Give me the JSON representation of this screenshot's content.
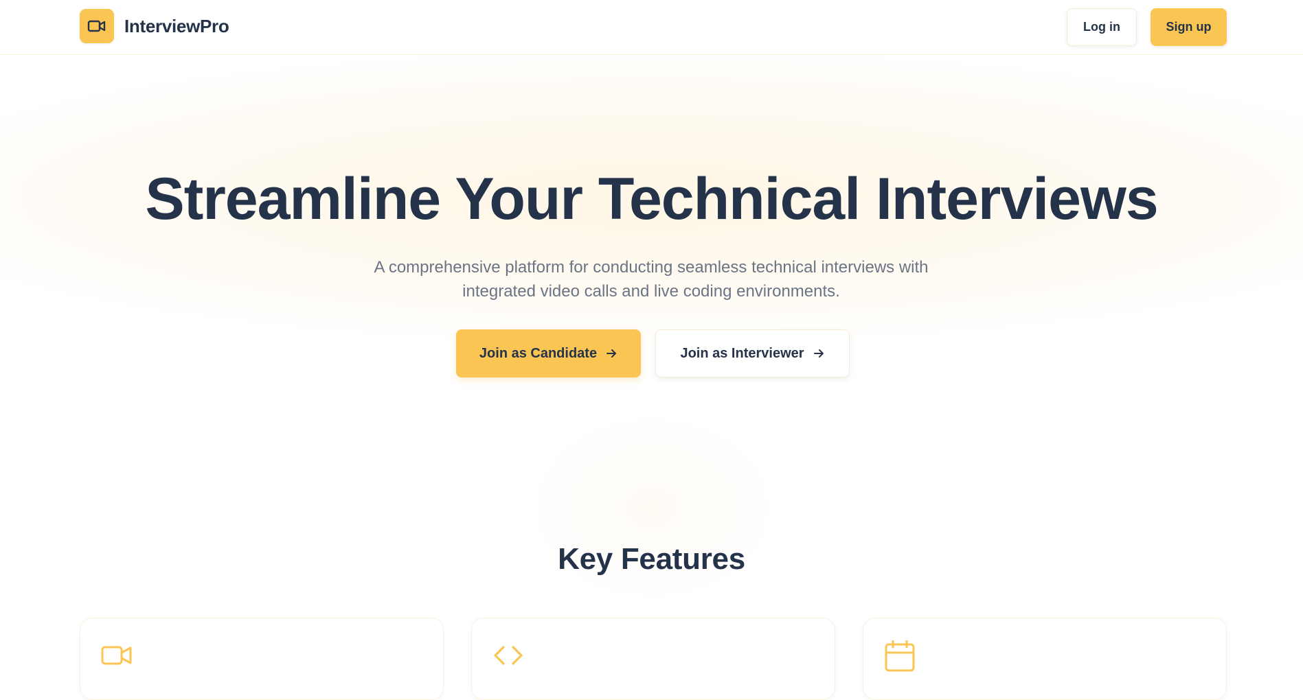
{
  "brand": {
    "name": "InterviewPro",
    "logo_icon": "video-camera-icon",
    "accent_color": "#fbc553"
  },
  "nav": {
    "login_label": "Log in",
    "signup_label": "Sign up"
  },
  "hero": {
    "title": "Streamline Your Technical Interviews",
    "subtitle": "A comprehensive platform for conducting seamless technical interviews with integrated video calls and live coding environments.",
    "cta_candidate": "Join as Candidate",
    "cta_interviewer": "Join as Interviewer",
    "cta_icon": "arrow-right-icon"
  },
  "features": {
    "title": "Key Features",
    "cards": [
      {
        "icon": "video-camera-icon"
      },
      {
        "icon": "code-icon"
      },
      {
        "icon": "calendar-icon"
      }
    ]
  },
  "colors": {
    "text": "#243349",
    "muted": "#6b7484",
    "accent": "#fbc553"
  }
}
